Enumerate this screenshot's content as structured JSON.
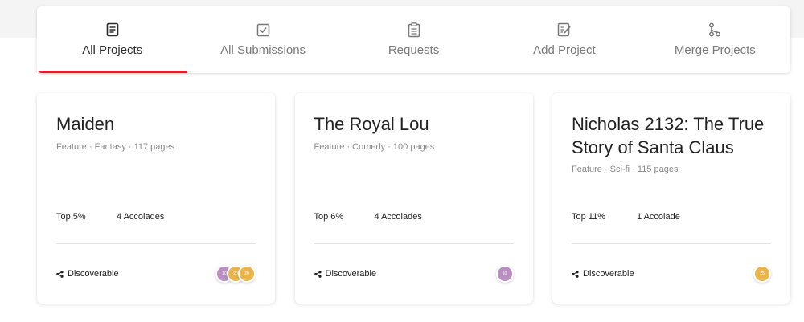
{
  "colors": {
    "accent": "#d8232a",
    "badge_purple": "#b98fc1",
    "badge_gold": "#e9b44c"
  },
  "tabs": [
    {
      "label": "All Projects",
      "icon": "document-icon",
      "active": true
    },
    {
      "label": "All Submissions",
      "icon": "checkbox-icon",
      "active": false
    },
    {
      "label": "Requests",
      "icon": "clipboard-icon",
      "active": false
    },
    {
      "label": "Add Project",
      "icon": "edit-document-icon",
      "active": false
    },
    {
      "label": "Merge Projects",
      "icon": "merge-icon",
      "active": false
    }
  ],
  "projects": [
    {
      "title": "Maiden",
      "meta": "Feature · Fantasy · 117 pages",
      "rank": "Top 5%",
      "accolades": "4 Accolades",
      "visibility": "Discoverable",
      "badges": [
        {
          "text": "10",
          "color": "#b98fc1"
        },
        {
          "text": "20",
          "color": "#e9b44c"
        },
        {
          "text": "20",
          "color": "#e9b44c"
        }
      ]
    },
    {
      "title": "The Royal Lou",
      "meta": "Feature · Comedy · 100 pages",
      "rank": "Top 6%",
      "accolades": "4 Accolades",
      "visibility": "Discoverable",
      "badges": [
        {
          "text": "10",
          "color": "#b98fc1"
        }
      ]
    },
    {
      "title": "Nicholas 2132: The True Story of Santa Claus",
      "meta": "Feature · Sci-fi · 115 pages",
      "rank": "Top 11%",
      "accolades": "1 Accolade",
      "visibility": "Discoverable",
      "badges": [
        {
          "text": "25",
          "color": "#e9b44c"
        }
      ]
    }
  ]
}
